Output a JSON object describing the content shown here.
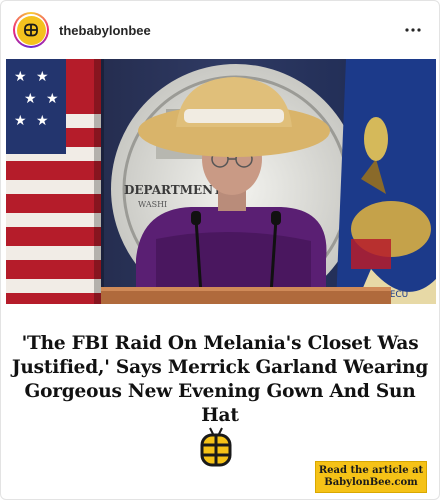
{
  "post": {
    "username": "thebabylonbee",
    "more_icon": "more-horizontal-icon",
    "avatar_icon": "babylon-bee-logo-icon",
    "photo": {
      "seal_text": "DEPARTMENT",
      "seal_subtext": "WASHI"
    },
    "headline": "'The FBI Raid On Melania's Closet Was Justified,' Says Merrick Garland Wearing Gorgeous New Evening Gown And Sun Hat",
    "cta": {
      "line1": "Read the article at",
      "line2": "BabylonBee.com"
    },
    "colors": {
      "brand_yellow": "#f5c217",
      "gown_purple": "#5a1f73",
      "hat_straw": "#d9b46a"
    }
  }
}
